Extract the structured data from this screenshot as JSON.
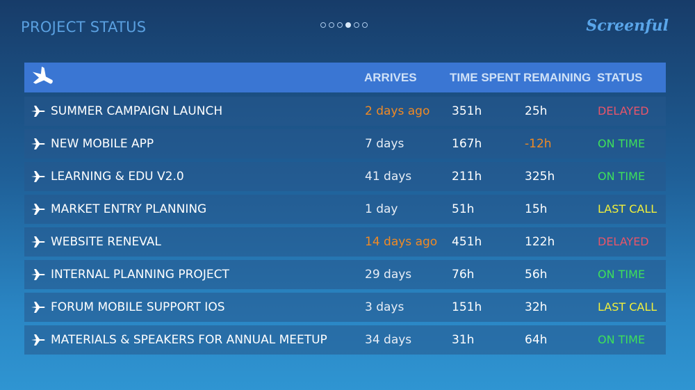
{
  "header": {
    "title": "PROJECT STATUS",
    "brand": "Screenful",
    "pager": {
      "total": 6,
      "active_index": 3
    }
  },
  "table": {
    "columns": [
      "ARRIVES",
      "TIME SPENT",
      "REMAINING",
      "STATUS"
    ],
    "rows": [
      {
        "name": "SUMMER CAMPAIGN  LAUNCH",
        "arrives": "2 days ago",
        "arrives_overdue": true,
        "spent": "351h",
        "remaining": "25h",
        "remaining_negative": false,
        "status": "DELAYED"
      },
      {
        "name": "NEW MOBILE APP",
        "arrives": "7 days",
        "arrives_overdue": false,
        "spent": "167h",
        "remaining": "-12h",
        "remaining_negative": true,
        "status": "ON TIME"
      },
      {
        "name": "LEARNING & EDU V2.0",
        "arrives": "41 days",
        "arrives_overdue": false,
        "spent": "211h",
        "remaining": "325h",
        "remaining_negative": false,
        "status": "ON TIME"
      },
      {
        "name": "MARKET ENTRY PLANNING",
        "arrives": "1 day",
        "arrives_overdue": false,
        "spent": "51h",
        "remaining": "15h",
        "remaining_negative": false,
        "status": "LAST CALL"
      },
      {
        "name": "WEBSITE RENEVAL",
        "arrives": "14 days ago",
        "arrives_overdue": true,
        "spent": "451h",
        "remaining": "122h",
        "remaining_negative": false,
        "status": "DELAYED"
      },
      {
        "name": "INTERNAL PLANNING PROJECT",
        "arrives": "29 days",
        "arrives_overdue": false,
        "spent": "76h",
        "remaining": "56h",
        "remaining_negative": false,
        "status": "ON TIME"
      },
      {
        "name": "FORUM MOBILE SUPPORT IOS",
        "arrives": "3 days",
        "arrives_overdue": false,
        "spent": "151h",
        "remaining": "32h",
        "remaining_negative": false,
        "status": "LAST CALL"
      },
      {
        "name": "MATERIALS & SPEAKERS FOR ANNUAL MEETUP",
        "arrives": "34 days",
        "arrives_overdue": false,
        "spent": "31h",
        "remaining": "64h",
        "remaining_negative": false,
        "status": "ON TIME"
      }
    ]
  },
  "status_colors": {
    "DELAYED": "#e8556a",
    "ON TIME": "#3ee05a",
    "LAST CALL": "#f2f03a"
  },
  "icons": {
    "header": "airplane-landing-icon",
    "row": "airplane-icon"
  }
}
